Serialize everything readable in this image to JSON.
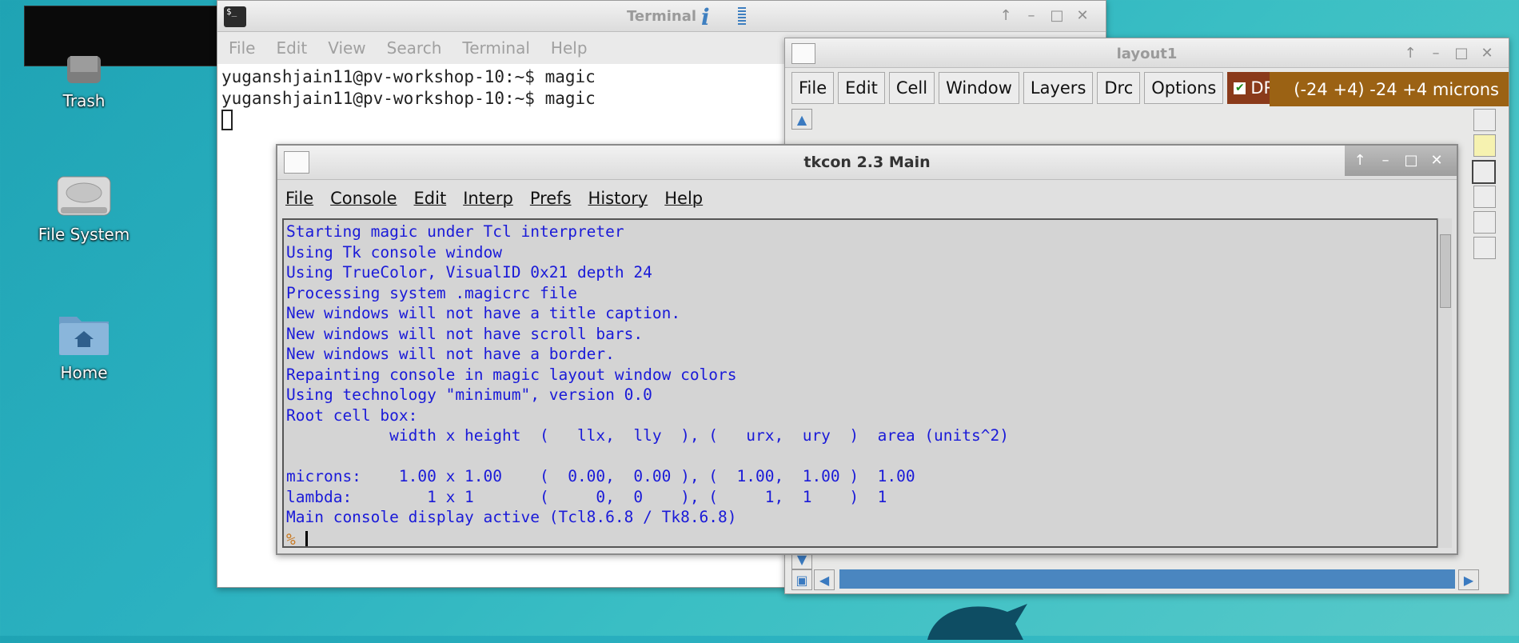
{
  "desktop": {
    "icons": [
      {
        "label": "Trash",
        "icon": "trash-icon"
      },
      {
        "label": "File System",
        "icon": "drive-icon"
      },
      {
        "label": "Home",
        "icon": "home-folder-icon"
      }
    ]
  },
  "terminal": {
    "title": "Terminal",
    "menu": [
      "File",
      "Edit",
      "View",
      "Search",
      "Terminal",
      "Help"
    ],
    "lines": [
      "yuganshjain11@pv-workshop-10:~$ magic",
      "yuganshjain11@pv-workshop-10:~$ magic"
    ]
  },
  "layout1": {
    "title": "layout1",
    "menu": [
      "File",
      "Edit",
      "Cell",
      "Window",
      "Layers",
      "Drc",
      "Options"
    ],
    "drc_label": "DRC",
    "coords": "(-24 +4) -24 +4 microns"
  },
  "tkcon": {
    "title": "tkcon 2.3 Main",
    "menu": [
      "File",
      "Console",
      "Edit",
      "Interp",
      "Prefs",
      "History",
      "Help"
    ],
    "output": "Starting magic under Tcl interpreter\nUsing Tk console window\nUsing TrueColor, VisualID 0x21 depth 24\nProcessing system .magicrc file\nNew windows will not have a title caption.\nNew windows will not have scroll bars.\nNew windows will not have a border.\nRepainting console in magic layout window colors\nUsing technology \"minimum\", version 0.0\nRoot cell box:\n           width x height  (   llx,  lly  ), (   urx,  ury  )  area (units^2)\n\nmicrons:    1.00 x 1.00    (  0.00,  0.00 ), (  1.00,  1.00 )  1.00\nlambda:        1 x 1       (     0,  0    ), (     1,  1    )  1\nMain console display active (Tcl8.6.8 / Tk8.6.8)",
    "prompt": "%"
  }
}
